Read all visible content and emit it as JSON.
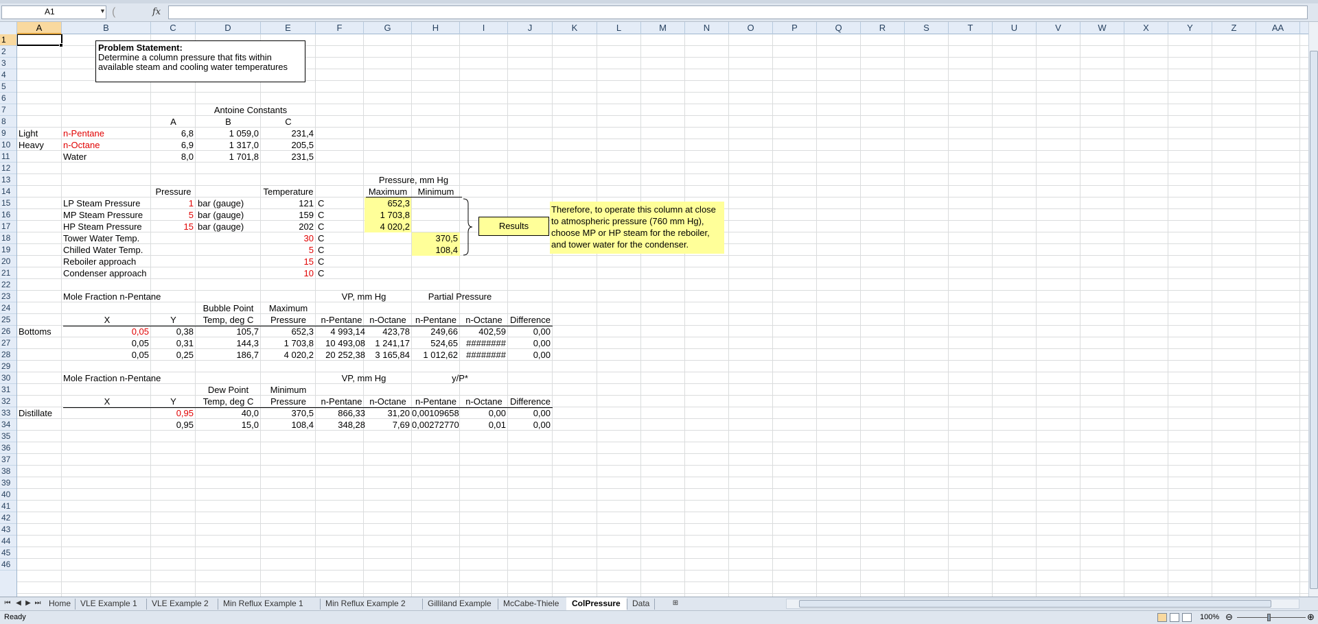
{
  "name_box": "A1",
  "formula_bar": {
    "fx": "fx",
    "content": ""
  },
  "columns": [
    "A",
    "B",
    "C",
    "D",
    "E",
    "F",
    "G",
    "H",
    "I",
    "J",
    "K",
    "L",
    "M",
    "N",
    "O",
    "P",
    "Q",
    "R",
    "S",
    "T",
    "U",
    "V",
    "W",
    "X",
    "Y",
    "Z",
    "AA"
  ],
  "rows": [
    "1",
    "2",
    "3",
    "4",
    "5",
    "6",
    "7",
    "8",
    "9",
    "10",
    "11",
    "12",
    "13",
    "14",
    "15",
    "16",
    "17",
    "18",
    "19",
    "20",
    "21",
    "22",
    "23",
    "24",
    "25",
    "26",
    "27",
    "28",
    "29",
    "30",
    "31",
    "32",
    "33",
    "34",
    "35",
    "36",
    "37",
    "38",
    "39",
    "40",
    "41",
    "42",
    "43",
    "44",
    "45",
    "46"
  ],
  "problem": {
    "title": "Problem Statement:",
    "line1": "Determine  a column  pressure  that fits within",
    "line2": "available  steam and cooling water temperatures"
  },
  "antoine": {
    "title": "Antoine Constants",
    "headers": [
      "A",
      "B",
      "C"
    ],
    "rows": [
      {
        "label": "Light",
        "name": "n-Pentane",
        "a": "6,8",
        "b": "1 059,0",
        "c": "231,4"
      },
      {
        "label": "Heavy",
        "name": "n-Octane",
        "a": "6,9",
        "b": "1 317,0",
        "c": "205,5"
      },
      {
        "label": "",
        "name": "Water",
        "a": "8,0",
        "b": "1 701,8",
        "c": "231,5"
      }
    ]
  },
  "utilities": {
    "pressure_header": "Pressure",
    "temperature_header": "Temperature",
    "mmhg_header": "Pressure, mm Hg",
    "max_header": "Maximum",
    "min_header": "Minimum",
    "rows": [
      {
        "name": "LP Steam Pressure",
        "pressure": "1",
        "unit": "bar (gauge)",
        "temp": "121",
        "tunit": "C",
        "max": "652,3",
        "min": ""
      },
      {
        "name": "MP Steam Pressure",
        "pressure": "5",
        "unit": "bar (gauge)",
        "temp": "159",
        "tunit": "C",
        "max": "1 703,8",
        "min": ""
      },
      {
        "name": "HP Steam Pressure",
        "pressure": "15",
        "unit": "bar (gauge)",
        "temp": "202",
        "tunit": "C",
        "max": "4 020,2",
        "min": ""
      },
      {
        "name": "Tower Water Temp.",
        "pressure": "",
        "unit": "",
        "temp": "30",
        "tunit": "C",
        "max": "",
        "min": "370,5"
      },
      {
        "name": "Chilled Water Temp.",
        "pressure": "",
        "unit": "",
        "temp": "5",
        "tunit": "C",
        "max": "",
        "min": "108,4"
      },
      {
        "name": "Reboiler approach",
        "pressure": "",
        "unit": "",
        "temp": "15",
        "tunit": "C",
        "max": "",
        "min": ""
      },
      {
        "name": "Condenser approach",
        "pressure": "",
        "unit": "",
        "temp": "10",
        "tunit": "C",
        "max": "",
        "min": ""
      }
    ],
    "results_label": "Results",
    "note": [
      "Therefore, to operate this column at close",
      "to atmospheric pressure (760 mm Hg),",
      "choose MP or HP steam for the reboiler,",
      "and tower water for the condenser."
    ]
  },
  "bottoms": {
    "mole_fraction_title": "Mole Fraction n-Pentane",
    "vp_title": "VP, mm Hg",
    "pp_title": "Partial Pressure",
    "header_top": {
      "temp": "Bubble Point",
      "press": "Maximum"
    },
    "headers": [
      "X",
      "Y",
      "Temp, deg C",
      "Pressure",
      "n-Pentane",
      "n-Octane",
      "n-Pentane",
      "n-Octane",
      "Difference"
    ],
    "label": "Bottoms",
    "rows": [
      [
        "0,05",
        "0,38",
        "105,7",
        "652,3",
        "4 993,14",
        "423,78",
        "249,66",
        "402,59",
        "0,00"
      ],
      [
        "0,05",
        "0,31",
        "144,3",
        "1 703,8",
        "10 493,08",
        "1 241,17",
        "524,65",
        "########",
        "0,00"
      ],
      [
        "0,05",
        "0,25",
        "186,7",
        "4 020,2",
        "20 252,38",
        "3 165,84",
        "1 012,62",
        "########",
        "0,00"
      ]
    ]
  },
  "distillate": {
    "mole_fraction_title": "Mole Fraction n-Pentane",
    "vp_title": "VP, mm Hg",
    "yp_title": "y/P*",
    "header_top": {
      "temp": "Dew Point",
      "press": "Minimum"
    },
    "headers": [
      "X",
      "Y",
      "Temp, deg C",
      "Pressure",
      "n-Pentane",
      "n-Octane",
      "n-Pentane",
      "n-Octane",
      "Difference"
    ],
    "label": "Distillate",
    "rows": [
      [
        "",
        "0,95",
        "40,0",
        "370,5",
        "866,33",
        "31,20",
        "0,00109658",
        "0,00",
        "0,00"
      ],
      [
        "",
        "0,95",
        "15,0",
        "108,4",
        "348,28",
        "7,69",
        "0,00272770",
        "0,01",
        "0,00"
      ]
    ]
  },
  "sheet_tabs": [
    "Home",
    "VLE Example 1",
    "VLE Example 2",
    "Min Reflux Example 1",
    "Min Reflux Example 2",
    "Gilliland Example",
    "McCabe-Thiele",
    "ColPressure",
    "Data"
  ],
  "active_tab": "ColPressure",
  "status": {
    "ready": "Ready",
    "zoom": "100%"
  },
  "colors": {
    "accent": "#f9d99f",
    "highlight": "#ffff99",
    "input_red": "#e00000"
  }
}
